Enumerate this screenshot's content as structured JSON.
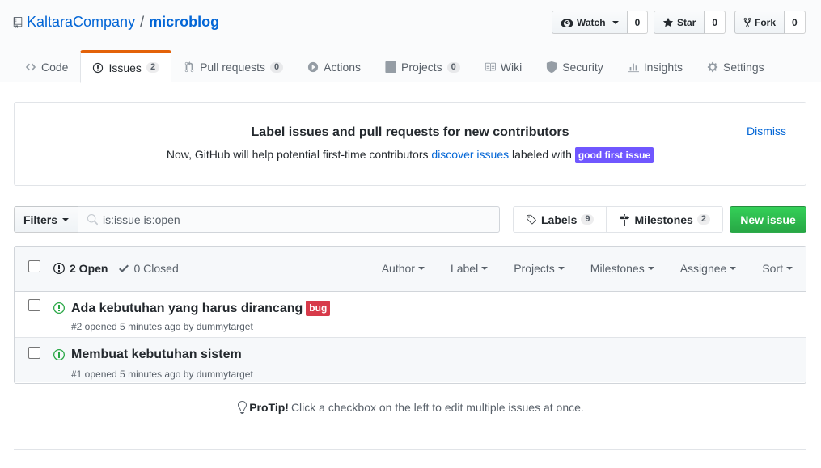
{
  "repo": {
    "owner": "KaltaraCompany",
    "separator": "/",
    "name": "microblog"
  },
  "actions": {
    "watch": {
      "label": "Watch",
      "count": "0"
    },
    "star": {
      "label": "Star",
      "count": "0"
    },
    "fork": {
      "label": "Fork",
      "count": "0"
    }
  },
  "tabs": [
    {
      "label": "Code",
      "icon": "code-icon"
    },
    {
      "label": "Issues",
      "icon": "issue-opened-icon",
      "count": "2"
    },
    {
      "label": "Pull requests",
      "icon": "git-pull-request-icon",
      "count": "0"
    },
    {
      "label": "Actions",
      "icon": "play-icon"
    },
    {
      "label": "Projects",
      "icon": "project-icon",
      "count": "0"
    },
    {
      "label": "Wiki",
      "icon": "book-icon"
    },
    {
      "label": "Security",
      "icon": "shield-icon"
    },
    {
      "label": "Insights",
      "icon": "graph-icon"
    },
    {
      "label": "Settings",
      "icon": "gear-icon"
    }
  ],
  "banner": {
    "title": "Label issues and pull requests for new contributors",
    "text_before": "Now, GitHub will help potential first-time contributors",
    "link": "discover issues",
    "text_after": "labeled with",
    "label": "good first issue",
    "dismiss": "Dismiss"
  },
  "subnav": {
    "filters_label": "Filters",
    "search_value": "is:issue is:open",
    "labels": {
      "label": "Labels",
      "count": "9"
    },
    "milestones": {
      "label": "Milestones",
      "count": "2"
    },
    "new_issue": "New issue"
  },
  "list": {
    "open_label": "2 Open",
    "closed_label": "0 Closed",
    "filters": [
      "Author",
      "Label",
      "Projects",
      "Milestones",
      "Assignee",
      "Sort"
    ],
    "issues": [
      {
        "title": "Ada kebutuhan yang harus dirancang",
        "label": "bug",
        "meta": "#2 opened 5 minutes ago by dummytarget"
      },
      {
        "title": "Membuat kebutuhan sistem",
        "meta": "#1 opened 5 minutes ago by dummytarget"
      }
    ]
  },
  "protip": {
    "strong": "ProTip!",
    "text": "Click a checkbox on the left to edit multiple issues at once."
  },
  "colors": {
    "accent": "#e36209",
    "link": "#0366d6",
    "primary": "#28a745",
    "bug": "#d73a4a",
    "good_first_issue": "#7057ff",
    "open": "#28a745"
  }
}
